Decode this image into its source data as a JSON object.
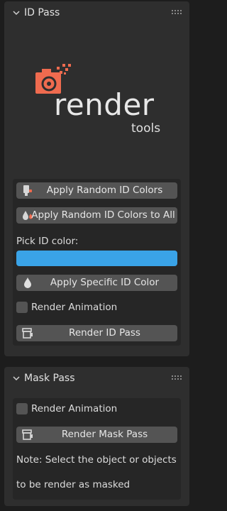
{
  "id_pass": {
    "title": "ID Pass",
    "logo": {
      "word": "render",
      "sub": "tools",
      "accent": "#ef6b4f"
    },
    "buttons": {
      "apply_random": "Apply Random ID Colors",
      "apply_random_all": "Apply Random ID Colors to All",
      "apply_specific": "Apply Specific ID Color",
      "render_id_pass": "Render ID Pass"
    },
    "pick_label": "Pick ID color:",
    "picked_color": "#3aa3e7",
    "render_animation": {
      "label": "Render Animation",
      "checked": false
    }
  },
  "mask_pass": {
    "title": "Mask Pass",
    "render_animation": {
      "label": "Render Animation",
      "checked": false
    },
    "render_button": "Render Mask Pass",
    "note_line1": "Note: Select the object or objects",
    "note_line2": "to be render as masked"
  },
  "icons": [
    "chevron-down-icon",
    "drag-grip-icon",
    "brush-icon",
    "droplet-icon",
    "render-icon"
  ],
  "colors": {
    "background": "#1d1d1d",
    "panel": "#2e2e2e",
    "box": "#262626",
    "button": "#545454",
    "accent_blue": "#3aa3e7"
  }
}
